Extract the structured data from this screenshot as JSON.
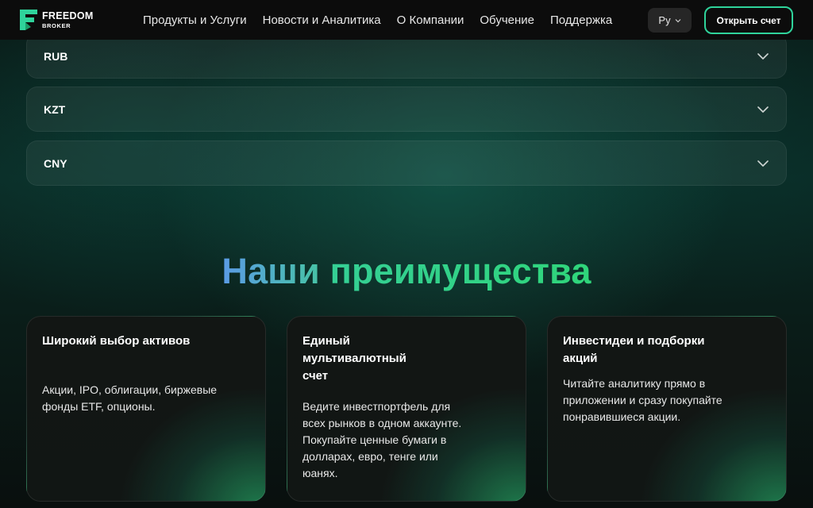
{
  "header": {
    "logo_title": "FREEDOM",
    "logo_sub": "BROKER",
    "nav": [
      "Продукты и Услуги",
      "Новости и Аналитика",
      "О Компании",
      "Обучение",
      "Поддержка"
    ],
    "lang": "Ру",
    "open_account": "Открыть счет"
  },
  "currencies": [
    "RUB",
    "KZT",
    "CNY"
  ],
  "advantages": {
    "title_part_1": "Наши",
    "title_part_2": "преимущества",
    "cards": [
      {
        "title": "Широкий выбор активов",
        "text": "Акции, IPO, облигации, биржевые фонды ETF, опционы."
      },
      {
        "title": "Единый мультивалютный счет",
        "text": "Ведите инвестпортфель для всех рынков в одном аккаунте. Покупайте ценные бумаги в долларах, евро, тенге или юанях."
      },
      {
        "title": "Инвестидеи и подборки акций",
        "text": "Читайте аналитику прямо в приложении и сразу покупайте понравившиеся акции."
      }
    ]
  },
  "colors": {
    "brand_green": "#2fd39b",
    "title_blue": "#5b9be6",
    "title_green": "#35cf95",
    "header_bg": "#0c0c0c"
  }
}
